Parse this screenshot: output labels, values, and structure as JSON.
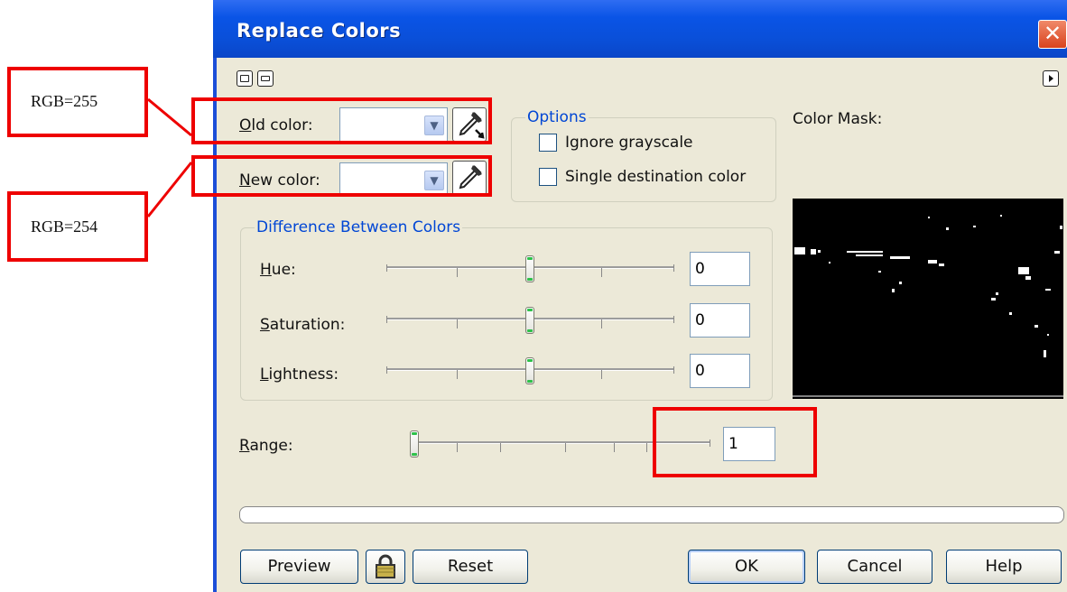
{
  "dialog": {
    "title": "Replace Colors",
    "close_glyph": "✕"
  },
  "old_color": {
    "label": "Old color:",
    "value": ""
  },
  "new_color": {
    "label": "New color:",
    "value": ""
  },
  "options": {
    "title": "Options",
    "ignore_grayscale": {
      "label": "Ignore grayscale",
      "checked": false
    },
    "single_destination": {
      "label": "Single destination color",
      "checked": false
    }
  },
  "color_mask": {
    "label": "Color Mask:"
  },
  "difference": {
    "title": "Difference Between Colors",
    "hue": {
      "label": "Hue:",
      "value": "0",
      "level": 0.5
    },
    "saturation": {
      "label": "Saturation:",
      "value": "0",
      "level": 0.5
    },
    "lightness": {
      "label": "Lightness:",
      "value": "0",
      "level": 0.5
    }
  },
  "range": {
    "label": "Range:",
    "value": "1",
    "level": 0.0
  },
  "buttons": {
    "preview": "Preview",
    "reset": "Reset",
    "ok": "OK",
    "cancel": "Cancel",
    "help": "Help"
  },
  "annotations": {
    "old": "RGB=255",
    "new": "RGB=254"
  },
  "colors": {
    "title_bar": "#0a54e6",
    "highlight": "#ee0000",
    "dialog_bg": "#ece9d8"
  }
}
